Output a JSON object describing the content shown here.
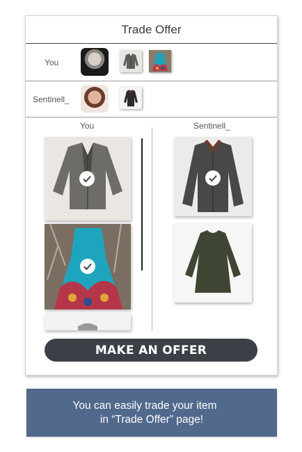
{
  "header": {
    "title": "Trade Offer"
  },
  "parties": {
    "you": {
      "name": "You",
      "item_count": 2
    },
    "other": {
      "name": "Sentinell_",
      "item_count": 1
    }
  },
  "columns": {
    "left_label": "You",
    "right_label": "Sentinell_"
  },
  "items": {
    "you": [
      {
        "name": "grey leather jacket",
        "selected": true
      },
      {
        "name": "teal patterned dress",
        "selected": true
      },
      {
        "name": "grey item",
        "selected": false
      }
    ],
    "other": [
      {
        "name": "dark waxed jacket",
        "selected": true
      },
      {
        "name": "olive blouse",
        "selected": false
      }
    ]
  },
  "actions": {
    "offer_label": "MAKE AN OFFER"
  },
  "banner": {
    "line1": "You can easily trade your item",
    "line2": "in “Trade Offer” page!"
  },
  "colors": {
    "button": "#3b4047",
    "banner": "#50698c"
  }
}
